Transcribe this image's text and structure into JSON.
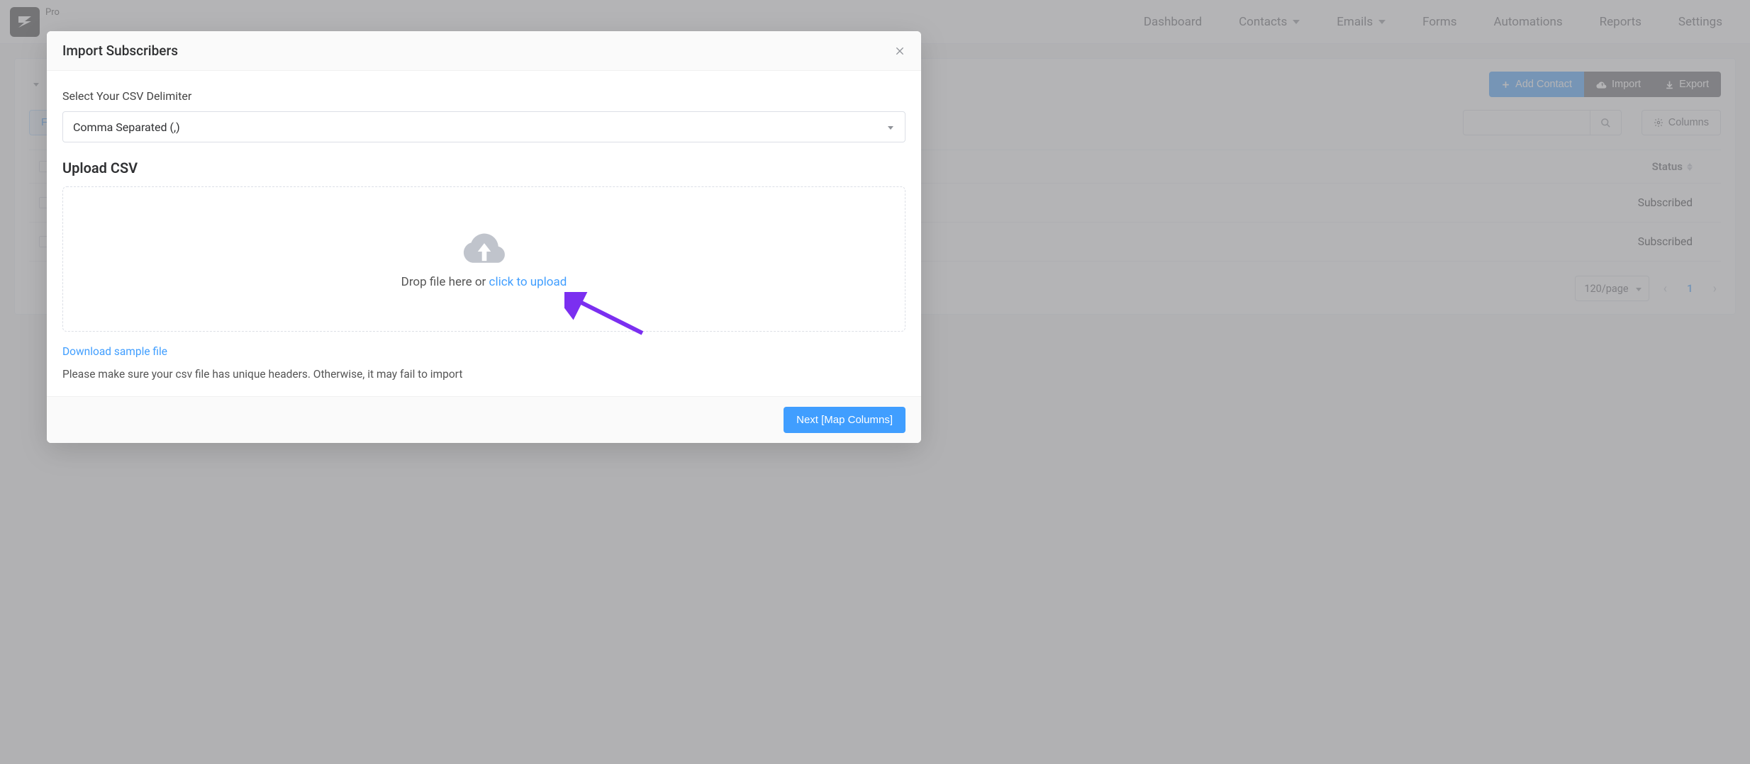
{
  "header": {
    "pro_label": "Pro",
    "nav": [
      "Dashboard",
      "Contacts",
      "Emails",
      "Forms",
      "Automations",
      "Reports",
      "Settings"
    ],
    "nav_has_dropdown": [
      false,
      true,
      true,
      false,
      false,
      false,
      false
    ]
  },
  "toolbar": {
    "add_contact_label": "Add Contact",
    "import_label": "Import",
    "export_label": "Export",
    "filter_label": "Filter",
    "columns_label": "Columns",
    "search_placeholder": ""
  },
  "table": {
    "status_header": "Status",
    "rows": [
      {
        "status": "Subscribed"
      },
      {
        "status": "Subscribed"
      }
    ],
    "page_size": "120/page",
    "current_page": "1"
  },
  "modal": {
    "title": "Import Subscribers",
    "delimiter_label": "Select Your CSV Delimiter",
    "delimiter_value": "Comma Separated (,)",
    "upload_heading": "Upload CSV",
    "drop_text_prefix": "Drop file here or ",
    "drop_text_link": "click to upload",
    "sample_link": "Download sample file",
    "hint": "Please make sure your csv file has unique headers. Otherwise, it may fail to import",
    "next_button": "Next [Map Columns]"
  },
  "colors": {
    "primary": "#409eff",
    "dark": "#606266",
    "annotation_arrow": "#7b2ff0"
  }
}
